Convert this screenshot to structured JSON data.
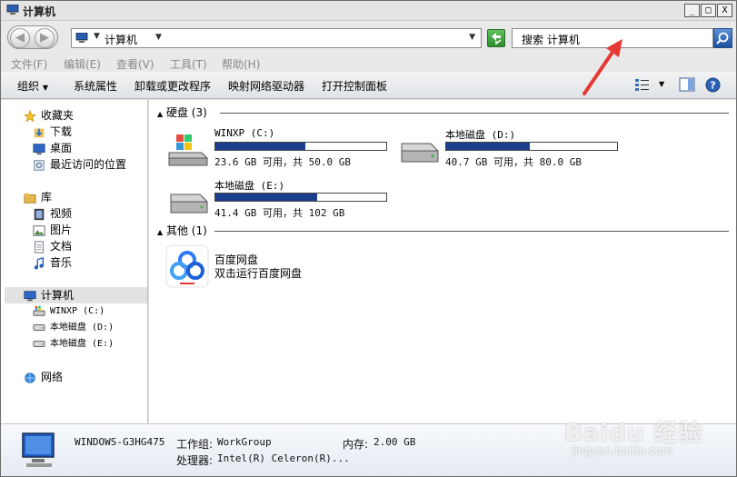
{
  "window": {
    "title": "计算机",
    "buttons": {
      "minimize": "_",
      "maximize": "□",
      "close": "X"
    }
  },
  "address": {
    "path": "计算机",
    "search_placeholder": "搜索 计算机"
  },
  "menu": [
    "文件(F)",
    "编辑(E)",
    "查看(V)",
    "工具(T)",
    "帮助(H)"
  ],
  "toolbar": {
    "items": [
      "组织",
      "系统属性",
      "卸载或更改程序",
      "映射网络驱动器",
      "打开控制面板"
    ],
    "organize_arrow": "▼",
    "view_arrow": "▼"
  },
  "sidebar": {
    "favorites": {
      "label": "收藏夹",
      "items": [
        "下载",
        "桌面",
        "最近访问的位置"
      ]
    },
    "library": {
      "label": "库",
      "items": [
        "视频",
        "图片",
        "文档",
        "音乐"
      ]
    },
    "computer": {
      "label": "计算机",
      "items": [
        "WINXP (C:)",
        "本地磁盘 (D:)",
        "本地磁盘 (E:)"
      ]
    },
    "network": {
      "label": "网络"
    }
  },
  "groups": {
    "hard_disks": {
      "label": "硬盘 (3)",
      "arrow": "▲"
    },
    "other": {
      "label": "其他 (1)",
      "arrow": "▲"
    }
  },
  "drives": [
    {
      "name": "WINXP (C:)",
      "info": "23.6 GB 可用，共 50.0 GB",
      "used_fraction": 0.528
    },
    {
      "name": "本地磁盘 (D:)",
      "info": "40.7 GB 可用，共 80.0 GB",
      "used_fraction": 0.49
    },
    {
      "name": "本地磁盘 (E:)",
      "info": "41.4 GB 可用，共 102 GB",
      "used_fraction": 0.594
    }
  ],
  "other_app": {
    "name": "百度网盘",
    "desc": "双击运行百度网盘"
  },
  "details": {
    "computer_name": "WINDOWS-G3HG475",
    "workgroup_label": "工作组:",
    "workgroup": "WorkGroup",
    "memory_label": "内存:",
    "memory": "2.00 GB",
    "processor_label": "处理器:",
    "processor": "Intel(R) Celeron(R)..."
  },
  "watermark": {
    "text": "Baidu 经验",
    "url": "jingyan.baidu.com"
  },
  "colors": {
    "accent_bar": "#1b3f8c",
    "arrow": "#e53935",
    "selection": "#e2e2e2"
  }
}
